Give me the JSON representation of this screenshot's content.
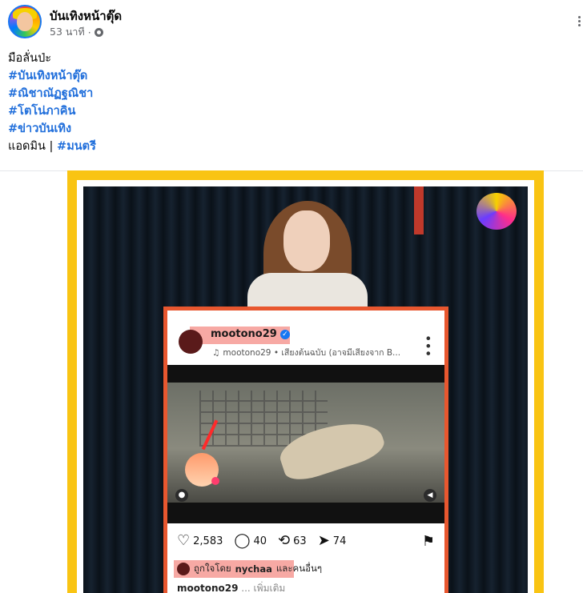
{
  "post": {
    "page_name": "บันเทิงหน้าตุ๊ด",
    "time": "53 นาที",
    "text": "มือลั่นป่ะ",
    "hashtags": [
      "#บันเทิงหน้าตุ๊ด",
      "#ณิชาณัฏฐณิชา",
      "#โตโน่ภาคิน",
      "#ข่าวบันเทิง"
    ],
    "admin_label": "แอดมิน |",
    "admin_tag": "#มนตรี"
  },
  "ig": {
    "username": "mootono29",
    "verified_mark": "✓",
    "audio_line": "mootono29 • เสียงต้นฉบับ (อาจมีเสียงจาก B...",
    "likes": "2,583",
    "comments": "40",
    "reposts": "63",
    "shares": "74",
    "liked_by_prefix": "ถูกใจโดย",
    "liked_by_user": "nychaa",
    "liked_by_suffix": "และคนอื่นๆ",
    "caption_user": "mootono29",
    "caption_more": "... เพิ่มเติม"
  },
  "icons": {
    "heart": "♡",
    "comment": "◯",
    "repost": "⟲",
    "share": "➤",
    "bookmark": "⚑",
    "music": "♫",
    "more": "•••",
    "user": "●",
    "sound": "◀"
  },
  "colors": {
    "hashtag": "#216fdb",
    "frame_yellow": "#f9c413",
    "ig_border": "#e8572f",
    "highlight": "#f7a9a4"
  }
}
